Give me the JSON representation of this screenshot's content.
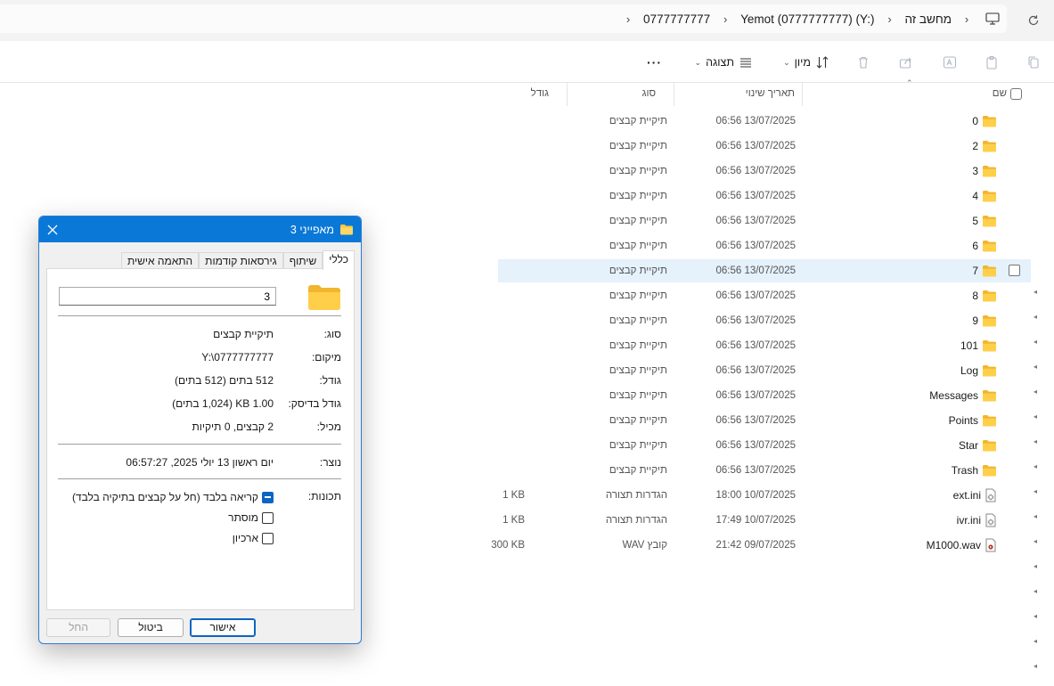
{
  "address": {
    "crumbs": [
      "מחשב זה",
      "Yemot (0777777777) (Y:)",
      "0777777777"
    ]
  },
  "toolbar": {
    "sort_label": "מיון",
    "view_label": "תצוגה",
    "more_label": "···"
  },
  "list": {
    "headers": {
      "name": "שם",
      "date": "תאריך שינוי",
      "type": "סוג",
      "size": "גודל"
    },
    "rows": [
      {
        "name": "0",
        "date": "13/07/2025 06:56",
        "type": "תיקיית קבצים",
        "size": "",
        "icon": "folder"
      },
      {
        "name": "2",
        "date": "13/07/2025 06:56",
        "type": "תיקיית קבצים",
        "size": "",
        "icon": "folder"
      },
      {
        "name": "3",
        "date": "13/07/2025 06:56",
        "type": "תיקיית קבצים",
        "size": "",
        "icon": "folder"
      },
      {
        "name": "4",
        "date": "13/07/2025 06:56",
        "type": "תיקיית קבצים",
        "size": "",
        "icon": "folder"
      },
      {
        "name": "5",
        "date": "13/07/2025 06:56",
        "type": "תיקיית קבצים",
        "size": "",
        "icon": "folder"
      },
      {
        "name": "6",
        "date": "13/07/2025 06:56",
        "type": "תיקיית קבצים",
        "size": "",
        "icon": "folder"
      },
      {
        "name": "7",
        "date": "13/07/2025 06:56",
        "type": "תיקיית קבצים",
        "size": "",
        "icon": "folder"
      },
      {
        "name": "8",
        "date": "13/07/2025 06:56",
        "type": "תיקיית קבצים",
        "size": "",
        "icon": "folder"
      },
      {
        "name": "9",
        "date": "13/07/2025 06:56",
        "type": "תיקיית קבצים",
        "size": "",
        "icon": "folder"
      },
      {
        "name": "101",
        "date": "13/07/2025 06:56",
        "type": "תיקיית קבצים",
        "size": "",
        "icon": "folder"
      },
      {
        "name": "Log",
        "date": "13/07/2025 06:56",
        "type": "תיקיית קבצים",
        "size": "",
        "icon": "folder"
      },
      {
        "name": "Messages",
        "date": "13/07/2025 06:56",
        "type": "תיקיית קבצים",
        "size": "",
        "icon": "folder"
      },
      {
        "name": "Points",
        "date": "13/07/2025 06:56",
        "type": "תיקיית קבצים",
        "size": "",
        "icon": "folder"
      },
      {
        "name": "Star",
        "date": "13/07/2025 06:56",
        "type": "תיקיית קבצים",
        "size": "",
        "icon": "folder"
      },
      {
        "name": "Trash",
        "date": "13/07/2025 06:56",
        "type": "תיקיית קבצים",
        "size": "",
        "icon": "folder"
      },
      {
        "name": "ext.ini",
        "date": "10/07/2025 18:00",
        "type": "הגדרות תצורה",
        "size": "1 KB",
        "icon": "ini"
      },
      {
        "name": "ivr.ini",
        "date": "10/07/2025 17:49",
        "type": "הגדרות תצורה",
        "size": "1 KB",
        "icon": "ini"
      },
      {
        "name": "M1000.wav",
        "date": "09/07/2025 21:42",
        "type": "קובץ WAV",
        "size": "300 KB",
        "icon": "wav"
      }
    ]
  },
  "dialog": {
    "title": "מאפייני 3",
    "tabs": [
      "כללי",
      "שיתוף",
      "גירסאות קודמות",
      "התאמה אישית"
    ],
    "name_value": "3",
    "props": [
      {
        "label": "סוג:",
        "value": "תיקיית קבצים"
      },
      {
        "label": "מיקום:",
        "value": "Y:\\0777777777"
      },
      {
        "label": "גודל:",
        "value": "512 בתים (512 בתים)"
      },
      {
        "label": "גודל בדיסק:",
        "value": "1.00 KB (1,024 בתים)"
      },
      {
        "label": "מכיל:",
        "value": "2 קבצים, 0 תיקיות"
      }
    ],
    "created_label": "נוצר:",
    "created_value": "יום ראשון 13 יולי 2025, 06:57:27",
    "attributes_label": "תכונות:",
    "attributes": [
      {
        "label": "קריאה בלבד (חל על קבצים בתיקיה בלבד)",
        "state": "indeterminate"
      },
      {
        "label": "מוסתר",
        "state": "unchecked"
      },
      {
        "label": "ארכיון",
        "state": "unchecked"
      }
    ],
    "buttons": {
      "ok": "אישור",
      "cancel": "ביטול",
      "apply": "החל"
    }
  },
  "colors": {
    "accent": "#0a78d7",
    "folder": "#ffc83d",
    "selected_row": "#e5f1fb"
  }
}
